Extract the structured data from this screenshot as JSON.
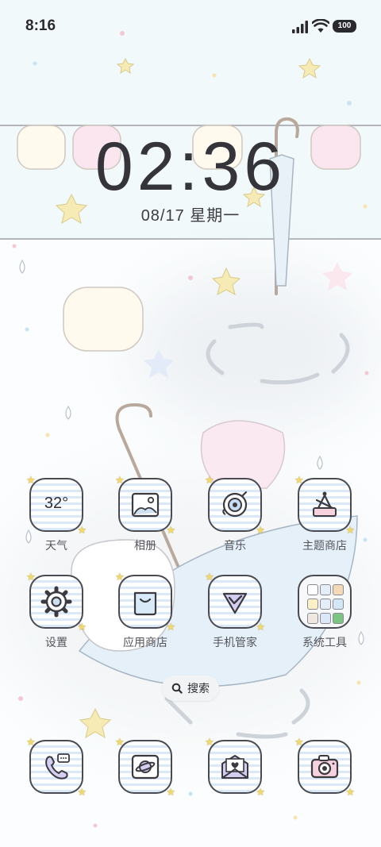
{
  "status_bar": {
    "time": "8:16",
    "battery": "100",
    "icons": [
      "signal-icon",
      "wifi-icon",
      "battery-icon"
    ]
  },
  "lock_clock": {
    "hour": "02",
    "separator": ":",
    "minute": "36",
    "date": "08/17 星期一"
  },
  "colors": {
    "icon_border": "#4a4a52",
    "stripe": "#dbe8f7",
    "star": "#f3d86a",
    "top_band": "#f1f9fb"
  },
  "apps": [
    {
      "label": "天气",
      "icon": "weather-icon",
      "value": "32°"
    },
    {
      "label": "相册",
      "icon": "gallery-icon"
    },
    {
      "label": "音乐",
      "icon": "music-icon"
    },
    {
      "label": "主题商店",
      "icon": "theme-store-icon"
    },
    {
      "label": "设置",
      "icon": "settings-gear-icon"
    },
    {
      "label": "应用商店",
      "icon": "app-store-bag-icon"
    },
    {
      "label": "手机管家",
      "icon": "security-shield-icon"
    },
    {
      "label": "系统工具",
      "icon": "system-tools-folder-icon"
    }
  ],
  "search": {
    "label": "搜索",
    "icon": "search-icon"
  },
  "dock": [
    {
      "name": "phone",
      "icon": "phone-icon"
    },
    {
      "name": "browser",
      "icon": "browser-planet-icon"
    },
    {
      "name": "messages",
      "icon": "messages-envelope-icon"
    },
    {
      "name": "camera",
      "icon": "camera-icon"
    }
  ]
}
